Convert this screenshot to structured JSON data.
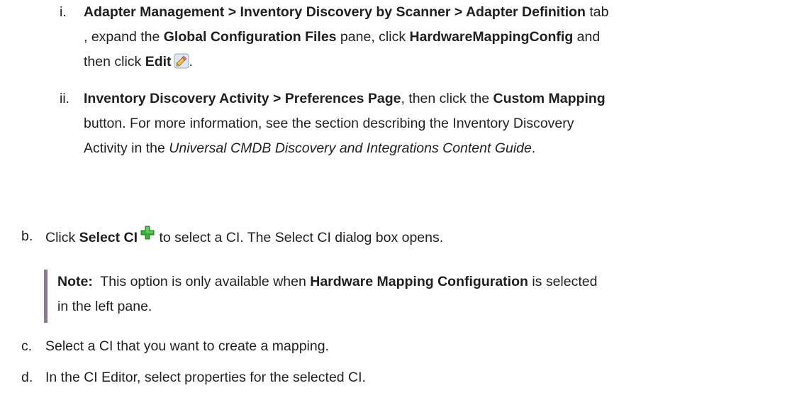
{
  "step_i": {
    "marker": "i.",
    "line1_bold1": "Adapter Management > Inventory Discovery by Scanner > Adapter Definition",
    "line1_tail": " tab",
    "line2_head": ", expand the ",
    "line2_bold1": "Global Configuration Files",
    "line2_mid": " pane, click ",
    "line2_bold2": "HardwareMappingConfig",
    "line2_tail": " and",
    "line3_head": "then click ",
    "line3_bold": "Edit",
    "line3_tail": ".",
    "edit_icon": "pencil-edit-icon"
  },
  "step_ii": {
    "marker": "ii.",
    "line1_bold1": "Inventory Discovery Activity > Preferences Page",
    "line1_mid": ", then click the ",
    "line1_bold2": "Custom Mapping",
    "line2": "button. For more information, see the section describing the Inventory Discovery",
    "line3_head": "Activity in the ",
    "line3_italic": "Universal CMDB Discovery and Integrations Content Guide",
    "line3_tail": "."
  },
  "step_b": {
    "marker": "b.",
    "head": "Click ",
    "bold": "Select CI",
    "tail": " to select a CI. The Select CI dialog box opens.",
    "add_icon": "green-plus-icon"
  },
  "note": {
    "label": "Note:",
    "line1_mid": "  This option is only available when ",
    "line1_bold": "Hardware Mapping Configuration",
    "line1_tail": " is selected",
    "line2": "in the left pane."
  },
  "step_c": {
    "marker": "c.",
    "text": "Select a CI that you want to create a mapping."
  },
  "step_d": {
    "marker": "d.",
    "text": "In the CI Editor, select properties for the selected CI."
  },
  "colors": {
    "text": "#1f1f1f",
    "note_bar": "#8a7a8e",
    "plus_green": "#3cae3c"
  }
}
